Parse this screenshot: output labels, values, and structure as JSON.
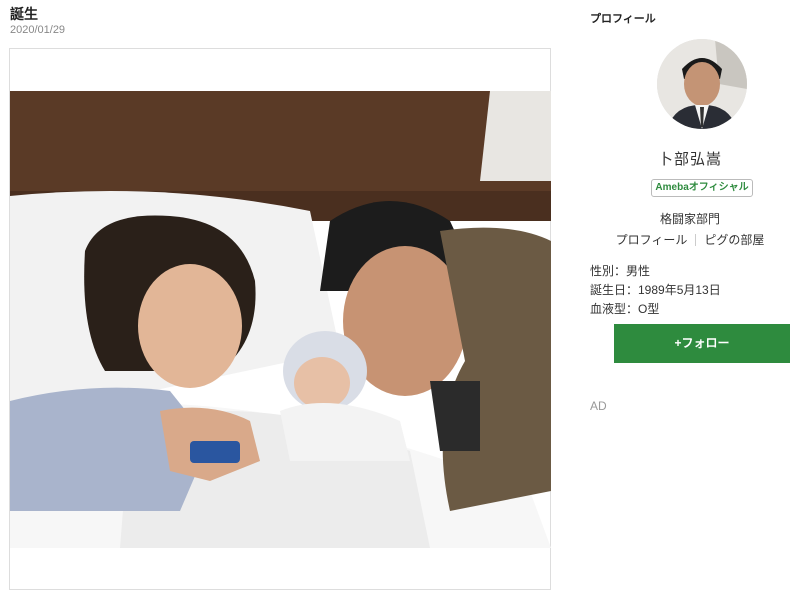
{
  "post": {
    "title": "誕生",
    "date": "2020/01/29"
  },
  "sidebar": {
    "heading": "プロフィール",
    "author_name": "卜部弘嵩",
    "official_badge": "Amebaオフィシャル",
    "category": "格闘家部門",
    "links": [
      "プロフィール",
      "ピグの部屋"
    ],
    "info": {
      "gender": "性別：男性",
      "birthday": "誕生日：1989年5月13日",
      "blood_type": "血液型：O型"
    },
    "follow_button": "+フォロー",
    "ad_label": "AD"
  },
  "colors": {
    "accent_green": "#2e8b3e"
  }
}
